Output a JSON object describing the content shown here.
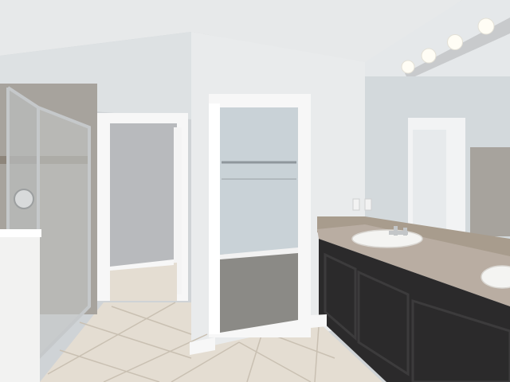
{
  "scene": {
    "description_visible_text": "",
    "colors": {
      "ceiling": "#e7e9ea",
      "wall": "#e9ebec",
      "wall_shadow": "#d6dadc",
      "closet_wall": "#c9d2d7",
      "closet_floor": "#8b8a86",
      "floor_tile": "#e4ddd2",
      "grout": "#c9c0b2",
      "cabinet": "#2b2a2b",
      "countertop": "#b9ada2",
      "backsplash_tile": "#a89c8d",
      "door_trim": "#f7f7f7",
      "glass_frame": "#c5c8ca",
      "shower_tile": "#a7a39d",
      "mirror_reflection": "#d3d9dc",
      "light_bulb": "#fffdf5",
      "sink": "#f4f4f2"
    }
  }
}
